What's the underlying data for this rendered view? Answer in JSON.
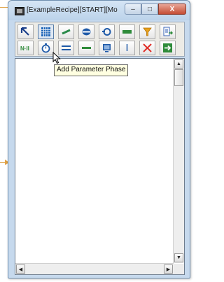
{
  "window": {
    "title": "[ExampleRecipe][START][Mo...",
    "buttons": {
      "minimize": "–",
      "maximize": "□",
      "close": "X"
    }
  },
  "toolbar": {
    "row1": [
      {
        "icon": "pointer-arrow-icon"
      },
      {
        "icon": "parameter-phase-grid-icon",
        "active": true
      },
      {
        "icon": "link-line-icon"
      },
      {
        "icon": "step-oval-icon"
      },
      {
        "icon": "loop-icon"
      },
      {
        "icon": "transition-bar-icon"
      },
      {
        "icon": "filter-funnel-icon"
      },
      {
        "icon": "document-export-icon"
      }
    ],
    "row2": [
      {
        "icon": "null-phase-icon",
        "label": "N·II"
      },
      {
        "icon": "timer-stopwatch-icon"
      },
      {
        "icon": "parallel-bars-icon"
      },
      {
        "icon": "divergence-icon"
      },
      {
        "icon": "monitor-icon"
      },
      {
        "icon": "arrow-down-icon"
      },
      {
        "icon": "delete-x-icon"
      },
      {
        "icon": "enter-green-arrow-icon"
      }
    ]
  },
  "tooltip": {
    "text": "Add Parameter Phase"
  },
  "colors": {
    "accent_orange": "#e0a246",
    "window_frame": "#c6d9ed",
    "toolbar_bg": "#ecebe6",
    "tooltip_bg": "#ffffe1"
  }
}
